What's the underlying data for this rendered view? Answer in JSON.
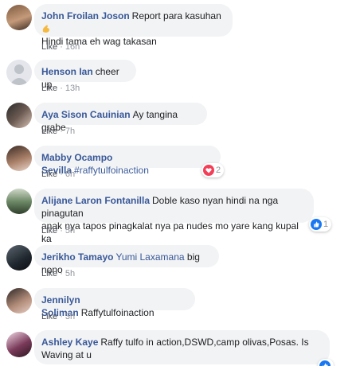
{
  "comments": [
    {
      "author": "John Froilan Joson",
      "text": "Report para kasuhan",
      "text2": "Hindi tama eh wag takasan",
      "like": "Like",
      "time": "16h"
    },
    {
      "author": "Henson Ian",
      "text": "cheer up",
      "like": "Like",
      "time": "13h"
    },
    {
      "author": "Aya Sison Cauinian",
      "text": "Ay tangina grabe",
      "like": "Like",
      "time": "7h"
    },
    {
      "author": "Mabby Ocampo Sevilla",
      "tag": "#raffytulfoinaction",
      "like": "Like",
      "time": "6h",
      "reaction_icon": "love-icon",
      "reaction_count": "2"
    },
    {
      "author": "Alijane Laron Fontanilla",
      "text": "Doble kaso nyan hindi na nga pinagutan",
      "text2": "anak nya tapos pinagkalat nya pa nudes mo yare kang kupal ka",
      "like": "Like",
      "time": "5h",
      "reaction_icon": "like-icon",
      "reaction_count": "1"
    },
    {
      "author": "Jerikho Tamayo",
      "tag": "Yumi Laxamana",
      "text": "big nono",
      "like": "Like",
      "time": "5h"
    },
    {
      "author": "Jennilyn Soliman",
      "text": "Raffytulfoinaction",
      "like": "Like",
      "time": "3h"
    },
    {
      "author": "Ashley Kaye",
      "text": "Raffy tulfo in action,DSWD,camp olivas,Posas. Is",
      "text2": "Waving at u",
      "like": "Like",
      "time": "",
      "reaction_icon": "like-icon",
      "reaction_count": ""
    }
  ],
  "colors": {
    "author": "#385898",
    "bubble": "#f2f3f5",
    "meta": "#90949c",
    "love": "#f33e58",
    "like": "#1877f2"
  }
}
